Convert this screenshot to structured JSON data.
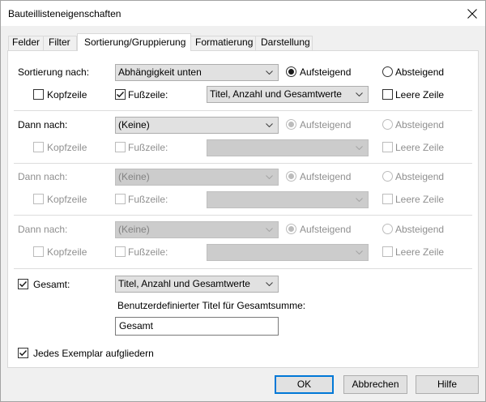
{
  "window": {
    "title": "Bauteillisteneigenschaften"
  },
  "icons": {
    "close": "close-icon",
    "dropdown": "chevron-down-icon",
    "check": "checkmark-icon"
  },
  "tabs": [
    {
      "label": "Felder",
      "active": false
    },
    {
      "label": "Filter",
      "active": false
    },
    {
      "label": "Sortierung/Gruppierung",
      "active": true
    },
    {
      "label": "Formatierung",
      "active": false
    },
    {
      "label": "Darstellung",
      "active": false
    }
  ],
  "sort_groups": [
    {
      "label": "Sortierung nach:",
      "field": "Abhängigkeit unten",
      "field_enabled": true,
      "options_enabled": true,
      "ascending_label": "Aufsteigend",
      "ascending_selected": true,
      "descending_label": "Absteigend",
      "descending_selected": false,
      "header_label": "Kopfzeile",
      "header_checked": false,
      "footer_label": "Fußzeile:",
      "footer_checked": true,
      "footer_value": "Titel, Anzahl und Gesamtwerte",
      "blank_line_label": "Leere Zeile",
      "blank_line_checked": false
    },
    {
      "label": "Dann nach:",
      "field": "(Keine)",
      "field_enabled": true,
      "options_enabled": false,
      "ascending_label": "Aufsteigend",
      "ascending_selected": true,
      "descending_label": "Absteigend",
      "descending_selected": false,
      "header_label": "Kopfzeile",
      "header_checked": false,
      "footer_label": "Fußzeile:",
      "footer_checked": false,
      "blank_line_label": "Leere Zeile",
      "blank_line_checked": false
    },
    {
      "label": "Dann nach:",
      "field": "(Keine)",
      "field_enabled": false,
      "options_enabled": false,
      "ascending_label": "Aufsteigend",
      "ascending_selected": true,
      "descending_label": "Absteigend",
      "descending_selected": false,
      "header_label": "Kopfzeile",
      "header_checked": false,
      "footer_label": "Fußzeile:",
      "footer_checked": false,
      "blank_line_label": "Leere Zeile",
      "blank_line_checked": false
    },
    {
      "label": "Dann nach:",
      "field": "(Keine)",
      "field_enabled": false,
      "options_enabled": false,
      "ascending_label": "Aufsteigend",
      "ascending_selected": true,
      "descending_label": "Absteigend",
      "descending_selected": false,
      "header_label": "Kopfzeile",
      "header_checked": false,
      "footer_label": "Fußzeile:",
      "footer_checked": false,
      "blank_line_label": "Leere Zeile",
      "blank_line_checked": false
    }
  ],
  "grand_totals": {
    "label": "Gesamt:",
    "checked": true,
    "value": "Titel, Anzahl und Gesamtwerte"
  },
  "custom_grand_total_title": {
    "label": "Benutzerdefinierter Titel für Gesamtsumme:",
    "value": "Gesamt"
  },
  "itemize_every_instance": {
    "label": "Jedes Exemplar aufgliedern",
    "checked": true
  },
  "buttons": {
    "ok": "OK",
    "cancel": "Abbrechen",
    "help": "Hilfe"
  }
}
